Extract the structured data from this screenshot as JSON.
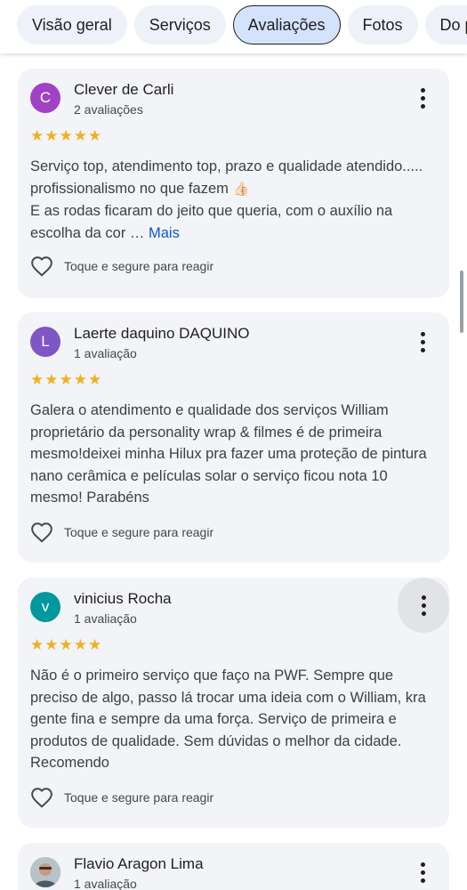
{
  "tabs": [
    {
      "label": "Visão geral",
      "active": false
    },
    {
      "label": "Serviços",
      "active": false
    },
    {
      "label": "Avaliações",
      "active": true
    },
    {
      "label": "Fotos",
      "active": false
    },
    {
      "label": "Do proprietário",
      "active": false
    }
  ],
  "reviews": [
    {
      "initial": "C",
      "avatar_color": "#a142c4",
      "author": "Clever de Carli",
      "count": "2 avaliações",
      "stars": "★★★★★",
      "text_1": "Serviço top, atendimento top, prazo e qualidade atendido..... profissionalismo no que fazem ",
      "emoji": "👍🏻",
      "text_2": "E as rodas ficaram do jeito que queria, com o auxílio na escolha da cor … ",
      "more": "Mais",
      "react_label": "Toque e segure para reagir"
    },
    {
      "initial": "L",
      "avatar_color": "#7e57c2",
      "author": "Laerte daquino DAQUINO",
      "count": "1 avaliação",
      "stars": "★★★★★",
      "text": "Galera o atendimento e qualidade dos serviços William proprietário da personality wrap & filmes é de primeira mesmo!deixei minha Hilux pra fazer uma proteção de pintura nano cerâmica e películas solar o serviço ficou nota 10 mesmo! Parabéns",
      "react_label": "Toque e segure para reagir"
    },
    {
      "initial": "v",
      "avatar_color": "#00979d",
      "author": "vinicius Rocha",
      "count": "1 avaliação",
      "stars": "★★★★★",
      "text": "Não é o primeiro serviço que faço na PWF. Sempre que preciso de algo, passo lá trocar uma ideia com o William, kra gente fina e sempre da uma força. Serviço de primeira e produtos de qualidade. Sem dúvidas o melhor da cidade. Recomendo",
      "react_label": "Toque e segure para reagir"
    },
    {
      "author": "Flavio Aragon Lima",
      "count": "1 avaliação"
    }
  ],
  "colors": {
    "star": "#f2b01e",
    "link": "#0b57d0",
    "card_bg": "#f3f4f8",
    "active_tab_bg": "#d3e3fd"
  },
  "icons": {
    "menu": "more-vert-icon",
    "react": "heart-outline-icon"
  }
}
